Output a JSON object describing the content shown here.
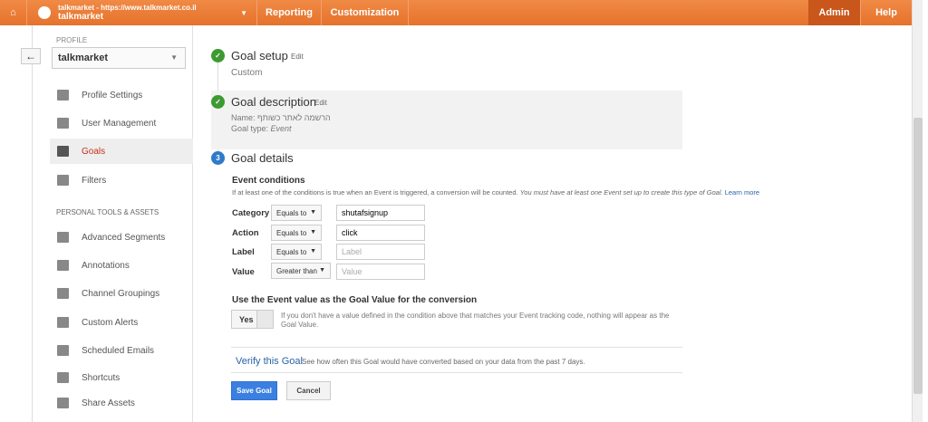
{
  "topbar": {
    "account_url": "talkmarket - https://www.talkmarket.co.il",
    "account_name": "talkmarket",
    "reporting": "Reporting",
    "customization": "Customization",
    "admin": "Admin",
    "help": "Help"
  },
  "sidebar": {
    "profile_label": "PROFILE",
    "profile_value": "talkmarket",
    "items": [
      {
        "label": "Profile Settings"
      },
      {
        "label": "User Management"
      },
      {
        "label": "Goals"
      },
      {
        "label": "Filters"
      }
    ],
    "section_header": "PERSONAL TOOLS & ASSETS",
    "tools": [
      {
        "label": "Advanced Segments"
      },
      {
        "label": "Annotations"
      },
      {
        "label": "Channel Groupings"
      },
      {
        "label": "Custom Alerts"
      },
      {
        "label": "Scheduled Emails"
      },
      {
        "label": "Shortcuts"
      },
      {
        "label": "Share Assets"
      }
    ]
  },
  "steps": {
    "setup_title": "Goal setup",
    "setup_value": "Custom",
    "edit": "Edit",
    "desc_title": "Goal description",
    "desc_name": "Name: הרשמה לאתר כשותף",
    "desc_type_label": "Goal type:",
    "desc_type": "Event",
    "details_num": "3",
    "details_title": "Goal details"
  },
  "conditions": {
    "title": "Event conditions",
    "note": "If at least one of the conditions is true when an Event is triggered, a conversion will be counted.",
    "note_italic": "You must have at least one Event set up to create this type of Goal.",
    "learn_more": "Learn more",
    "rows": [
      {
        "label": "Category",
        "op": "Equals to",
        "value": "shutafsignup",
        "placeholder": ""
      },
      {
        "label": "Action",
        "op": "Equals to",
        "value": "click",
        "placeholder": ""
      },
      {
        "label": "Label",
        "op": "Equals to",
        "value": "",
        "placeholder": "Label"
      },
      {
        "label": "Value",
        "op": "Greater than",
        "value": "",
        "placeholder": "Value"
      }
    ]
  },
  "goal_value": {
    "title": "Use the Event value as the Goal Value for the conversion",
    "toggle": "Yes",
    "note": "If you don't have a value defined in the condition above that matches your Event tracking code, nothing will appear as the Goal Value."
  },
  "verify": {
    "link": "Verify this Goal",
    "note": "See how often this Goal would have converted based on your data from the past 7 days."
  },
  "buttons": {
    "save": "Save Goal",
    "cancel": "Cancel"
  }
}
